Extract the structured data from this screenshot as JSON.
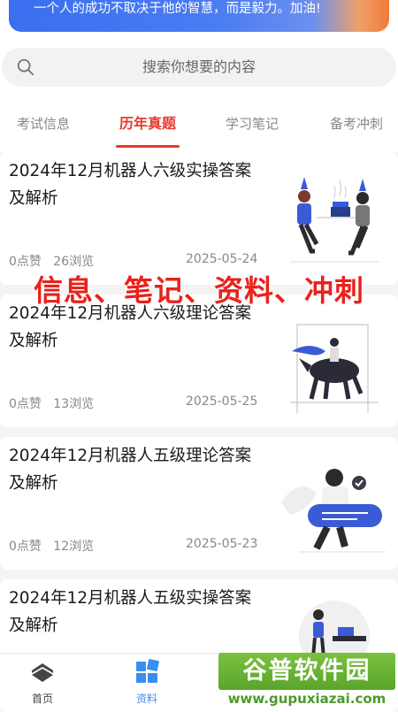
{
  "banner": {
    "text": "一个人的成功不取决于他的智慧，而是毅力。加油!"
  },
  "search": {
    "placeholder": "搜索你想要的内容"
  },
  "tabs": [
    {
      "label": "考试信息",
      "active": false
    },
    {
      "label": "历年真题",
      "active": true
    },
    {
      "label": "学习笔记",
      "active": false
    },
    {
      "label": "备考冲刺",
      "active": false
    }
  ],
  "articles": [
    {
      "title": "2024年12月机器人六级实操答案及解析",
      "likes": "0点赞",
      "views": "26浏览",
      "date": "2025-05-24",
      "image": "birthday-party-illustration"
    },
    {
      "title": "2024年12月机器人六级理论答案及解析",
      "likes": "0点赞",
      "views": "13浏览",
      "date": "2025-05-25",
      "image": "horse-rider-illustration"
    },
    {
      "title": "2024年12月机器人五级理论答案及解析",
      "likes": "0点赞",
      "views": "12浏览",
      "date": "2025-05-23",
      "image": "chat-bubble-illustration"
    },
    {
      "title": "2024年12月机器人五级实操答案及解析",
      "likes": "",
      "views": "",
      "date": "",
      "image": "desk-worker-illustration"
    }
  ],
  "overlay_caption": "信息、笔记、资料、冲刺",
  "tabbar": [
    {
      "label": "首页",
      "icon": "home-icon",
      "active": false
    },
    {
      "label": "资料",
      "icon": "grid-icon",
      "active": true
    }
  ],
  "watermark": {
    "top": "谷普软件园",
    "bottom": "www.gupuxiazai.com"
  },
  "colors": {
    "accent": "#e53b2c",
    "tabbar_active": "#3a8ef0",
    "banner": "#3a6ff0"
  }
}
